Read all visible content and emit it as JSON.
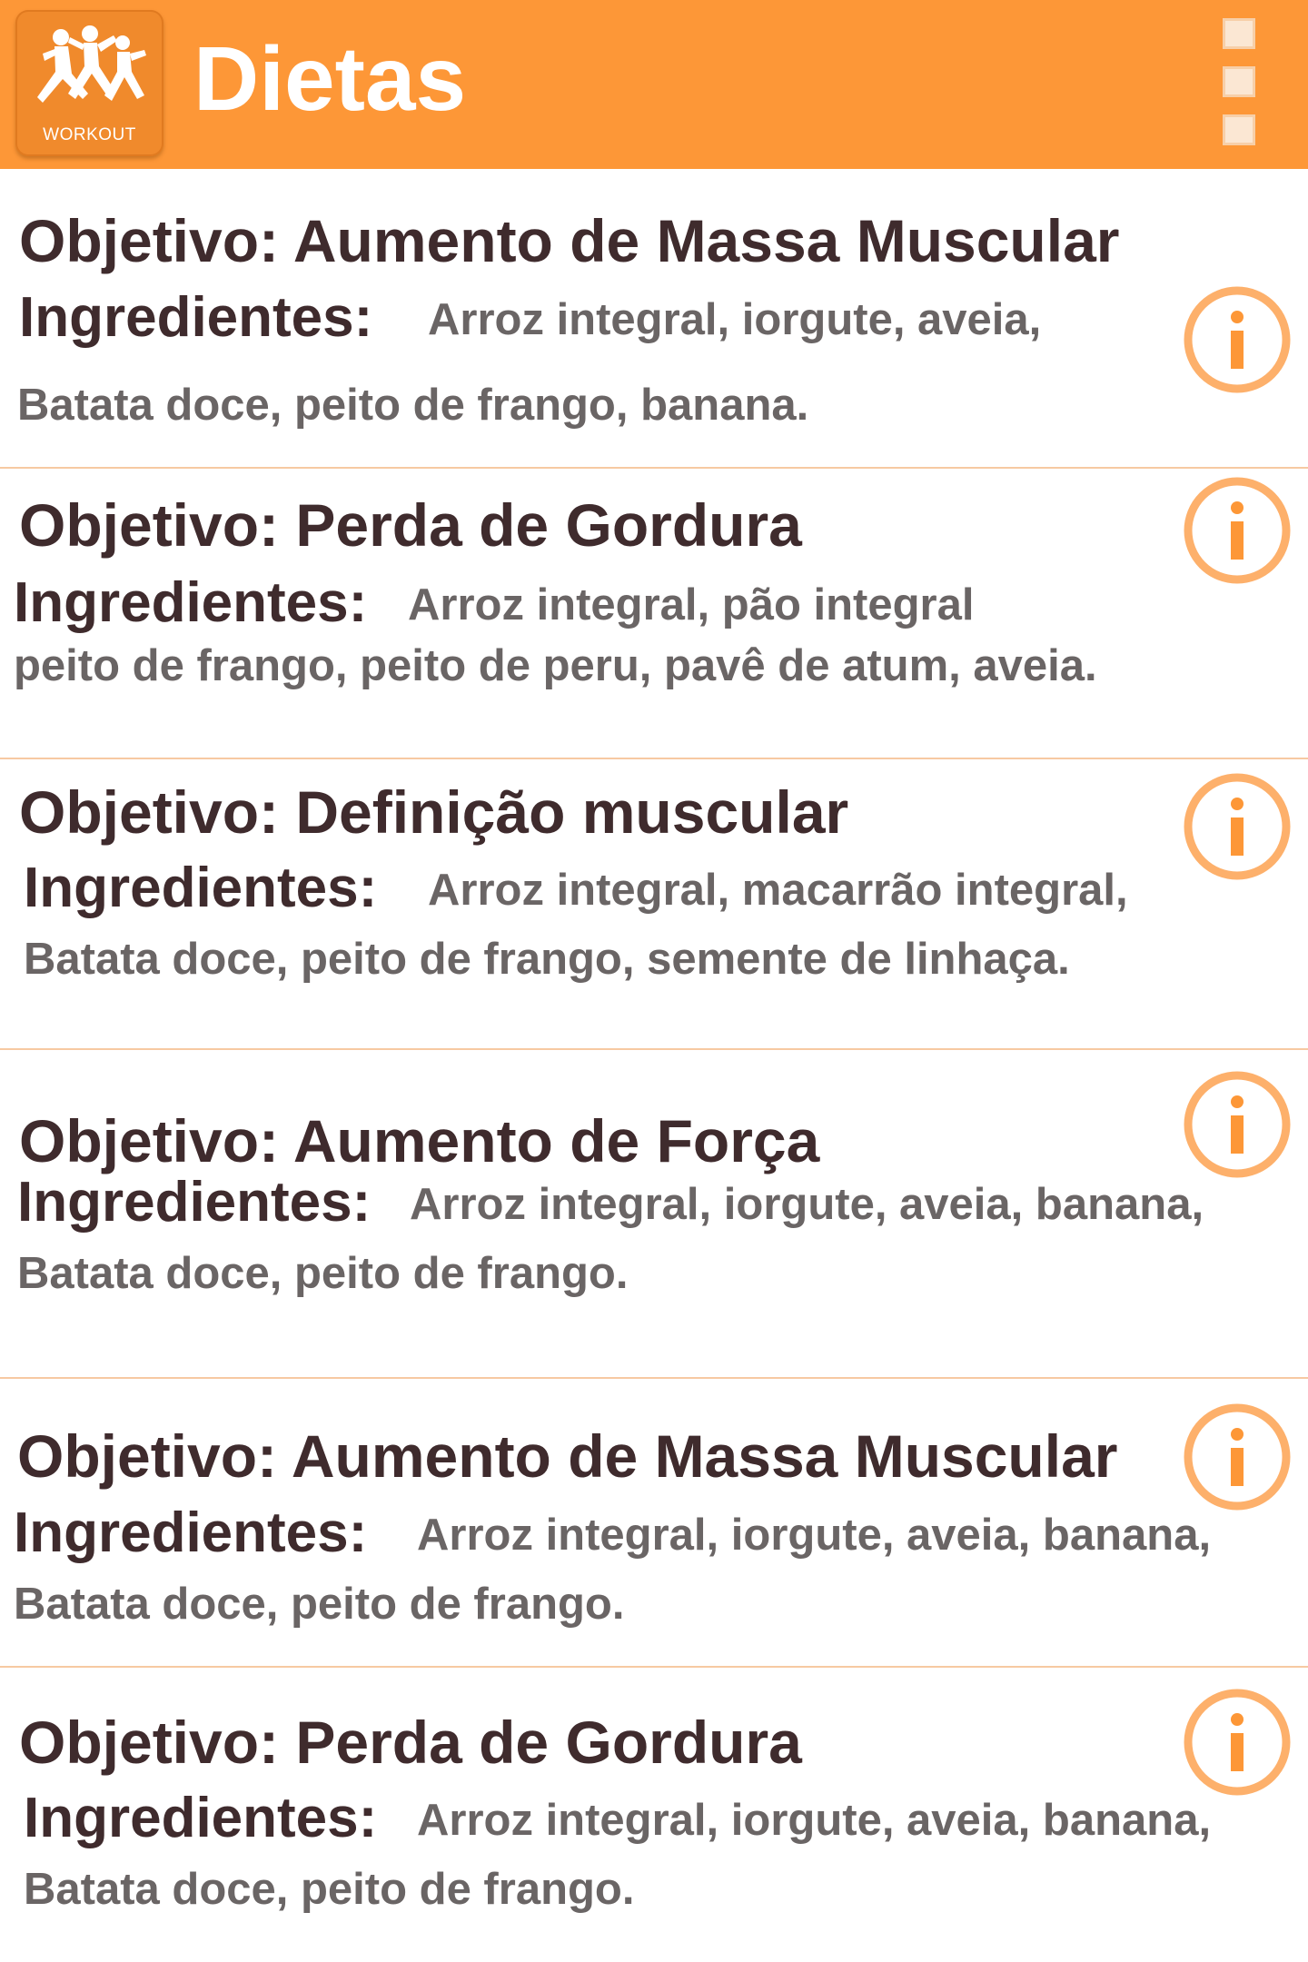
{
  "app_bar": {
    "logo_caption": "WORKOUT",
    "title": "Dietas",
    "accent_color": "#fd9737",
    "menu_icon": "overflow-menu-icon"
  },
  "diets": [
    {
      "objective": "Objetivo: Aumento de Massa Muscular",
      "ingredients_label": "Ingredientes:",
      "ingredients_line1": "Arroz integral, iorgute, aveia,",
      "ingredients_line2": "Batata doce, peito de frango, banana.",
      "icon": "info-icon"
    },
    {
      "objective": "Objetivo: Perda de Gordura",
      "ingredients_label": "Ingredientes:",
      "ingredients_line1": "Arroz integral, pão integral",
      "ingredients_line2": "peito de frango, peito de peru, pavê de atum, aveia.",
      "icon": "info-icon"
    },
    {
      "objective": "Objetivo: Definição muscular",
      "ingredients_label": "Ingredientes:",
      "ingredients_line1": "Arroz integral, macarrão integral,",
      "ingredients_line2": "Batata doce, peito de frango, semente de linhaça.",
      "icon": "info-icon"
    },
    {
      "objective": "Objetivo: Aumento de Força",
      "ingredients_label": "Ingredientes:",
      "ingredients_line1": "Arroz integral, iorgute, aveia, banana,",
      "ingredients_line2": "Batata doce, peito de frango.",
      "icon": "info-icon"
    },
    {
      "objective": "Objetivo: Aumento de Massa Muscular",
      "ingredients_label": "Ingredientes:",
      "ingredients_line1": "Arroz integral, iorgute, aveia, banana,",
      "ingredients_line2": "Batata doce, peito de frango.",
      "icon": "info-icon"
    },
    {
      "objective": "Objetivo: Perda de Gordura",
      "ingredients_label": "Ingredientes:",
      "ingredients_line1": "Arroz integral, iorgute, aveia, banana,",
      "ingredients_line2": "Batata doce, peito de frango.",
      "icon": "info-icon"
    }
  ]
}
